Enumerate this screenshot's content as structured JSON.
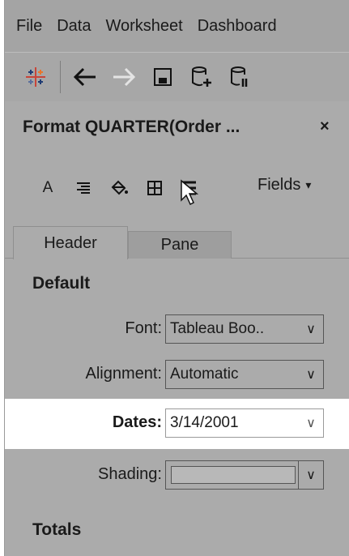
{
  "menubar": {
    "items": [
      "File",
      "Data",
      "Worksheet",
      "Dashboard"
    ]
  },
  "toolbar": {
    "icons": [
      "tableau-logo-icon",
      "back-arrow-icon",
      "forward-arrow-icon",
      "save-icon",
      "new-data-source-icon",
      "pause-auto-updates-icon"
    ]
  },
  "panel": {
    "title": "Format QUARTER(Order ...",
    "close": "×",
    "format_icons": {
      "font": "A",
      "align": "≡",
      "shading": "shading-icon",
      "borders": "⊞",
      "lines": "≡"
    },
    "fields_label": "Fields",
    "fields_caret": "▾"
  },
  "tabs": [
    {
      "label": "Header",
      "active": true
    },
    {
      "label": "Pane",
      "active": false
    }
  ],
  "sections": {
    "default_title": "Default",
    "totals_title": "Totals"
  },
  "rows": {
    "font": {
      "label": "Font:",
      "value": "Tableau Boo..",
      "chevron": "∨"
    },
    "alignment": {
      "label": "Alignment:",
      "value": "Automatic",
      "chevron": "∨"
    },
    "dates": {
      "label": "Dates:",
      "value": "3/14/2001",
      "chevron": "∨"
    },
    "shading": {
      "label": "Shading:",
      "chevron": "∨"
    }
  }
}
